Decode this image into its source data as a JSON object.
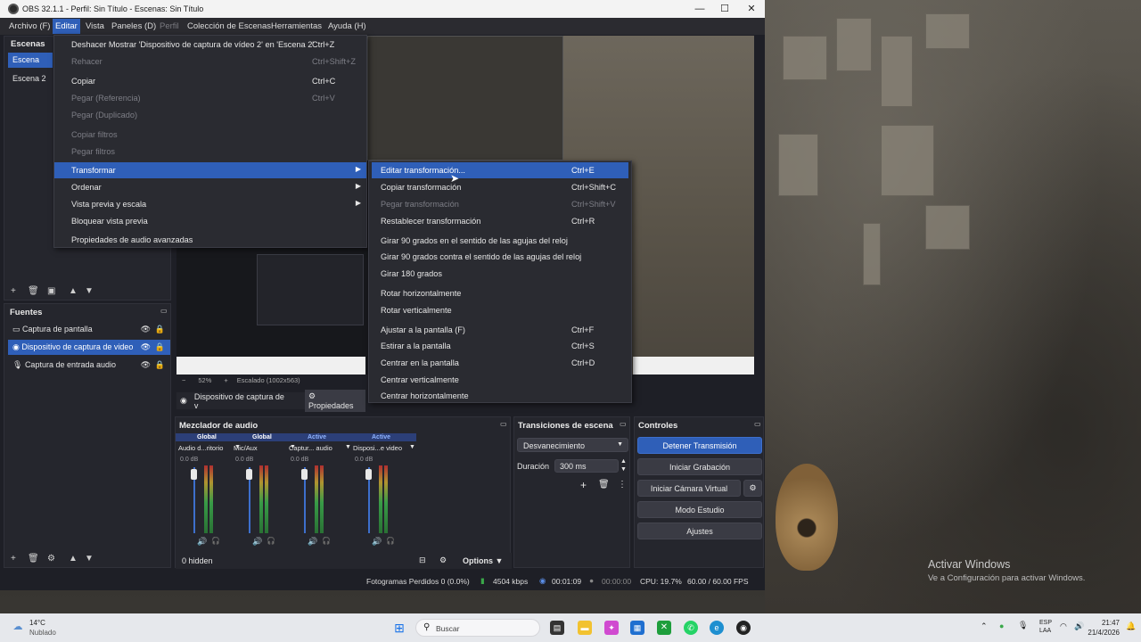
{
  "window": {
    "title": "OBS 32.1.1 - Perfil: Sin Título - Escenas: Sin Título",
    "controls": [
      "—",
      "☐",
      "✕"
    ]
  },
  "menubar": {
    "items": [
      {
        "label": "Archivo (F)"
      },
      {
        "label": "Editar"
      },
      {
        "label": "Vista"
      },
      {
        "label": "Paneles (D)"
      },
      {
        "label": "Perfil"
      },
      {
        "label": "Colección de Escenas"
      },
      {
        "label": "Herramientas"
      },
      {
        "label": "Ayuda (H)"
      }
    ]
  },
  "edit_menu": {
    "items": [
      {
        "label": "Deshacer Mostrar 'Dispositivo de captura de vídeo 2' en 'Escena 2'",
        "shortcut": "Ctrl+Z"
      },
      {
        "label": "Rehacer",
        "shortcut": "Ctrl+Shift+Z"
      },
      {
        "label": "Copiar",
        "shortcut": "Ctrl+C"
      },
      {
        "label": "Pegar (Referencia)",
        "shortcut": "Ctrl+V"
      },
      {
        "label": "Pegar (Duplicado)",
        "shortcut": ""
      },
      {
        "label": "Copiar filtros",
        "shortcut": ""
      },
      {
        "label": "Pegar filtros",
        "shortcut": ""
      },
      {
        "label": "Transformar",
        "shortcut": ""
      },
      {
        "label": "Ordenar",
        "shortcut": ""
      },
      {
        "label": "Vista previa y escala",
        "shortcut": ""
      },
      {
        "label": "Bloquear vista previa",
        "shortcut": ""
      },
      {
        "label": "Propiedades de audio avanzadas",
        "shortcut": ""
      }
    ]
  },
  "transform_menu": {
    "items": [
      {
        "label": "Editar transformación...",
        "shortcut": "Ctrl+E"
      },
      {
        "label": "Copiar transformación",
        "shortcut": "Ctrl+Shift+C"
      },
      {
        "label": "Pegar transformación",
        "shortcut": "Ctrl+Shift+V"
      },
      {
        "label": "Restablecer transformación",
        "shortcut": "Ctrl+R"
      },
      {
        "label": "Girar 90 grados en el sentido de las agujas del reloj",
        "shortcut": ""
      },
      {
        "label": "Girar 90 grados contra el sentido de las agujas del reloj",
        "shortcut": ""
      },
      {
        "label": "Girar 180 grados",
        "shortcut": ""
      },
      {
        "label": "Rotar horizontalmente",
        "shortcut": ""
      },
      {
        "label": "Rotar verticalmente",
        "shortcut": ""
      },
      {
        "label": "Ajustar a la pantalla (F)",
        "shortcut": "Ctrl+F"
      },
      {
        "label": "Estirar a la pantalla",
        "shortcut": "Ctrl+S"
      },
      {
        "label": "Centrar en la pantalla",
        "shortcut": "Ctrl+D"
      },
      {
        "label": "Centrar verticalmente",
        "shortcut": ""
      },
      {
        "label": "Centrar horizontalmente",
        "shortcut": ""
      }
    ]
  },
  "scenes": {
    "title": "Escenas",
    "items": [
      {
        "label": "Escena"
      },
      {
        "label": "Escena 2"
      }
    ]
  },
  "sources": {
    "title": "Fuentes",
    "items": [
      {
        "label": "Captura de pantalla"
      },
      {
        "label": "Dispositivo de captura de video"
      },
      {
        "label": "Captura de entrada audio"
      }
    ]
  },
  "preview_bar": {
    "source_label": "Dispositivo de captura de v",
    "properties": "Propiedades",
    "zoom": "52%",
    "scaled": "Escalado (1002x563)"
  },
  "mixer": {
    "title": "Mezclador de audio",
    "hidden": "0 hidden",
    "options": "Options",
    "channels": [
      {
        "tag": "Global",
        "name": "Audio d...ritorio",
        "db": "0.0 dB",
        "level": 0.45
      },
      {
        "tag": "Global",
        "name": "Mic/Aux",
        "db": "0.0 dB",
        "level": 0.35
      },
      {
        "tag": "Active",
        "name": "Captur... audio",
        "db": "0.0 dB",
        "level": 0.0
      },
      {
        "tag": "Active",
        "name": "Disposi...e video",
        "db": "0.0 dB",
        "level": 0.3
      }
    ],
    "scale": [
      "0",
      "-6",
      "-12",
      "-18",
      "-24",
      "-30",
      "-36",
      "-42",
      "-48",
      "-54",
      "-60"
    ]
  },
  "transitions": {
    "title": "Transiciones de escena",
    "selected": "Desvanecimiento",
    "duration_label": "Duración",
    "duration_value": "300 ms"
  },
  "controls": {
    "title": "Controles",
    "buttons": [
      {
        "label": "Detener Transmisión"
      },
      {
        "label": "Iniciar Grabación"
      },
      {
        "label": "Iniciar Cámara Virtual"
      },
      {
        "label": "Modo Estudio"
      },
      {
        "label": "Ajustes"
      }
    ]
  },
  "status": {
    "dropped": "Fotogramas Perdidos 0 (0.0%)",
    "bitrate": "4504 kbps",
    "stream_time": "00:01:09",
    "rec_time": "00:00:00",
    "cpu": "CPU: 19.7%",
    "fps": "60.00 / 60.00 FPS"
  },
  "desktop": {
    "activate_title": "Activar Windows",
    "activate_sub": "Ve a Configuración para activar Windows."
  },
  "taskbar": {
    "weather_temp": "14°C",
    "weather_desc": "Nublado",
    "search": "Buscar",
    "lang1": "ESP",
    "lang2": "LAA",
    "time": "21:47",
    "date": "21/4/2026"
  },
  "colors": {
    "accent": "#2f5fb8",
    "panel": "#25262d",
    "background": "#1e1f26"
  }
}
